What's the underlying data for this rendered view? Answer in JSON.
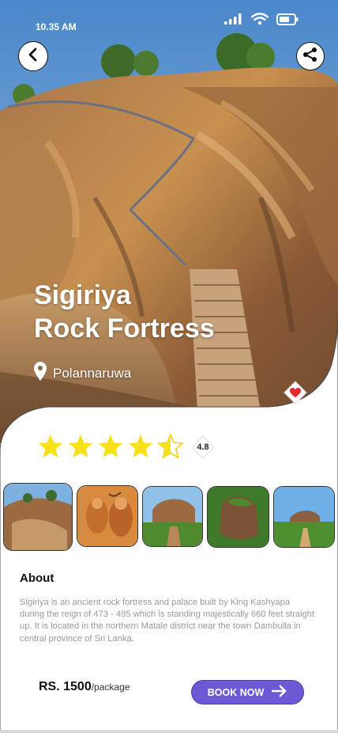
{
  "status_bar": {
    "time": "10.35 AM"
  },
  "header": {
    "back_icon": "arrow-left-icon",
    "share_icon": "share-icon"
  },
  "place": {
    "title_line1": "Sigiriya",
    "title_line2": "Rock Fortress",
    "location": "Polannaruwa",
    "favorite": true
  },
  "rating": {
    "stars": 4.5,
    "max_stars": 5,
    "value": "4.8"
  },
  "gallery": [
    {
      "name": "rock-stairs-photo"
    },
    {
      "name": "fresco-photo"
    },
    {
      "name": "rock-aerial-photo"
    },
    {
      "name": "rock-top-photo"
    },
    {
      "name": "rock-path-photo"
    }
  ],
  "about": {
    "heading": "About",
    "text": "Sigiriya is an ancient rock fortress and palace built by King Kashyapa during the reign of 473 - 495 which is standing majestically 660 feet straight up. It is located in the northern Matale district near the town Dambulla in central province of Sri Lanka."
  },
  "booking": {
    "price": "RS. 1500",
    "price_unit": "/package",
    "button_label": "BOOK NOW"
  },
  "colors": {
    "accent": "#6b5ad6",
    "star": "#f7e21a",
    "heart": "#e3262f"
  }
}
